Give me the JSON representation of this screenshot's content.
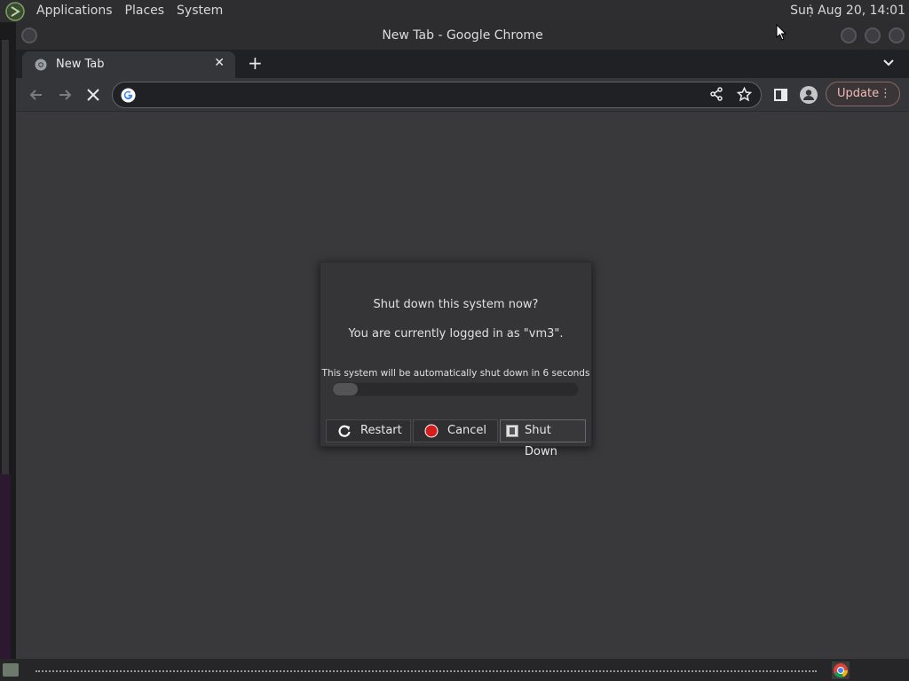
{
  "top_panel": {
    "menus": [
      "Applications",
      "Places",
      "System"
    ],
    "clock": "Sun Aug 20, 14:01"
  },
  "window": {
    "title": "New Tab - Google Chrome"
  },
  "browser": {
    "tab_title": "New Tab",
    "address_value": "",
    "update_label": "Update"
  },
  "dialog": {
    "question": "Shut down this system now?",
    "logged_in": "You are currently logged in as \"vm3\".",
    "auto_text": "This system will be automatically shut down in 6 seconds",
    "progress_fraction": 0.1,
    "buttons": {
      "restart": "Restart",
      "cancel": "Cancel",
      "shutdown": "Shut Down"
    }
  },
  "colors": {
    "update_accent": "#f2b8b5",
    "cancel_red": "#d21e1e"
  }
}
